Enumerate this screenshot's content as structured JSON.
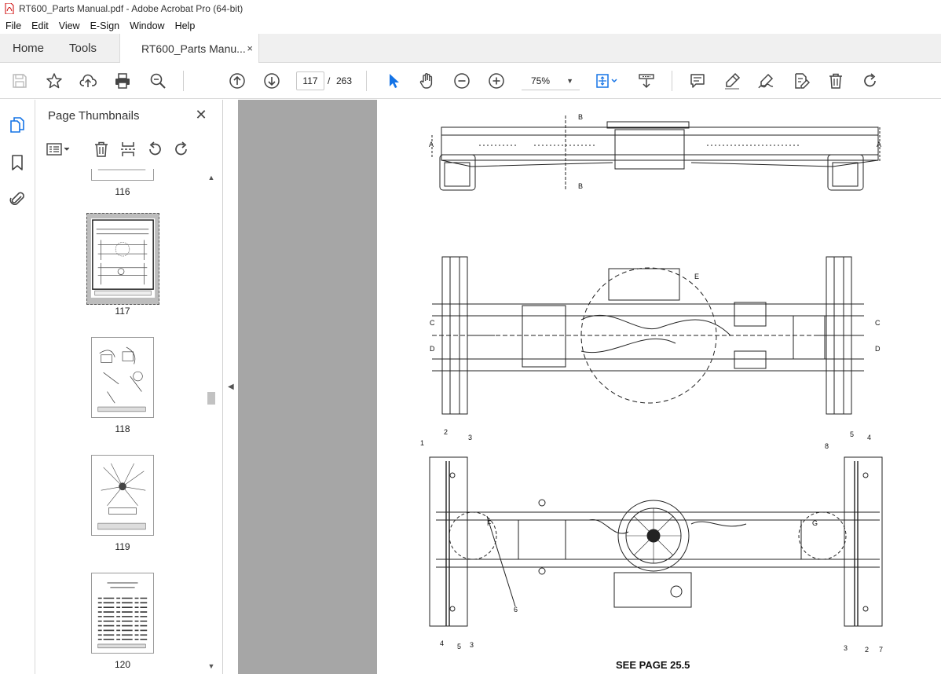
{
  "window": {
    "title": "RT600_Parts Manual.pdf - Adobe Acrobat Pro (64-bit)"
  },
  "menu": [
    "File",
    "Edit",
    "View",
    "E-Sign",
    "Window",
    "Help"
  ],
  "tabs": {
    "home": "Home",
    "tools": "Tools",
    "document": "RT600_Parts Manu...",
    "close": "×"
  },
  "toolbar": {
    "page_current": "117",
    "page_separator": "/",
    "page_total": "263",
    "zoom": "75%",
    "icons": [
      "save-icon",
      "bookmark-star-icon",
      "upload-icon",
      "print-icon",
      "zoom-search-icon",
      "page-up-icon",
      "page-down-icon",
      "select-cursor-icon",
      "hand-pan-icon",
      "zoom-out-icon",
      "zoom-in-icon",
      "fit-page-icon",
      "scroll-mode-icon",
      "comment-icon",
      "highlight-icon",
      "sign-icon",
      "edit-pdf-icon",
      "delete-icon",
      "redo-icon"
    ]
  },
  "sidebar": {
    "panel_title": "Page Thumbnails",
    "close": "✕",
    "thumbnails": [
      {
        "label": "116"
      },
      {
        "label": "117",
        "selected": true
      },
      {
        "label": "118"
      },
      {
        "label": "119"
      },
      {
        "label": "120"
      }
    ]
  },
  "document": {
    "caption": "SEE PAGE 25.5",
    "callouts": [
      "A",
      "A",
      "B",
      "B",
      "C",
      "D",
      "C",
      "D",
      "E",
      "F",
      "G",
      "1",
      "2",
      "3",
      "4",
      "5",
      "3",
      "6",
      "5",
      "4",
      "8",
      "3",
      "2",
      "7"
    ]
  },
  "colors": {
    "accent": "#1473e6",
    "doc_bg": "#a6a6a6",
    "tab_bg": "#f0f0f0"
  }
}
